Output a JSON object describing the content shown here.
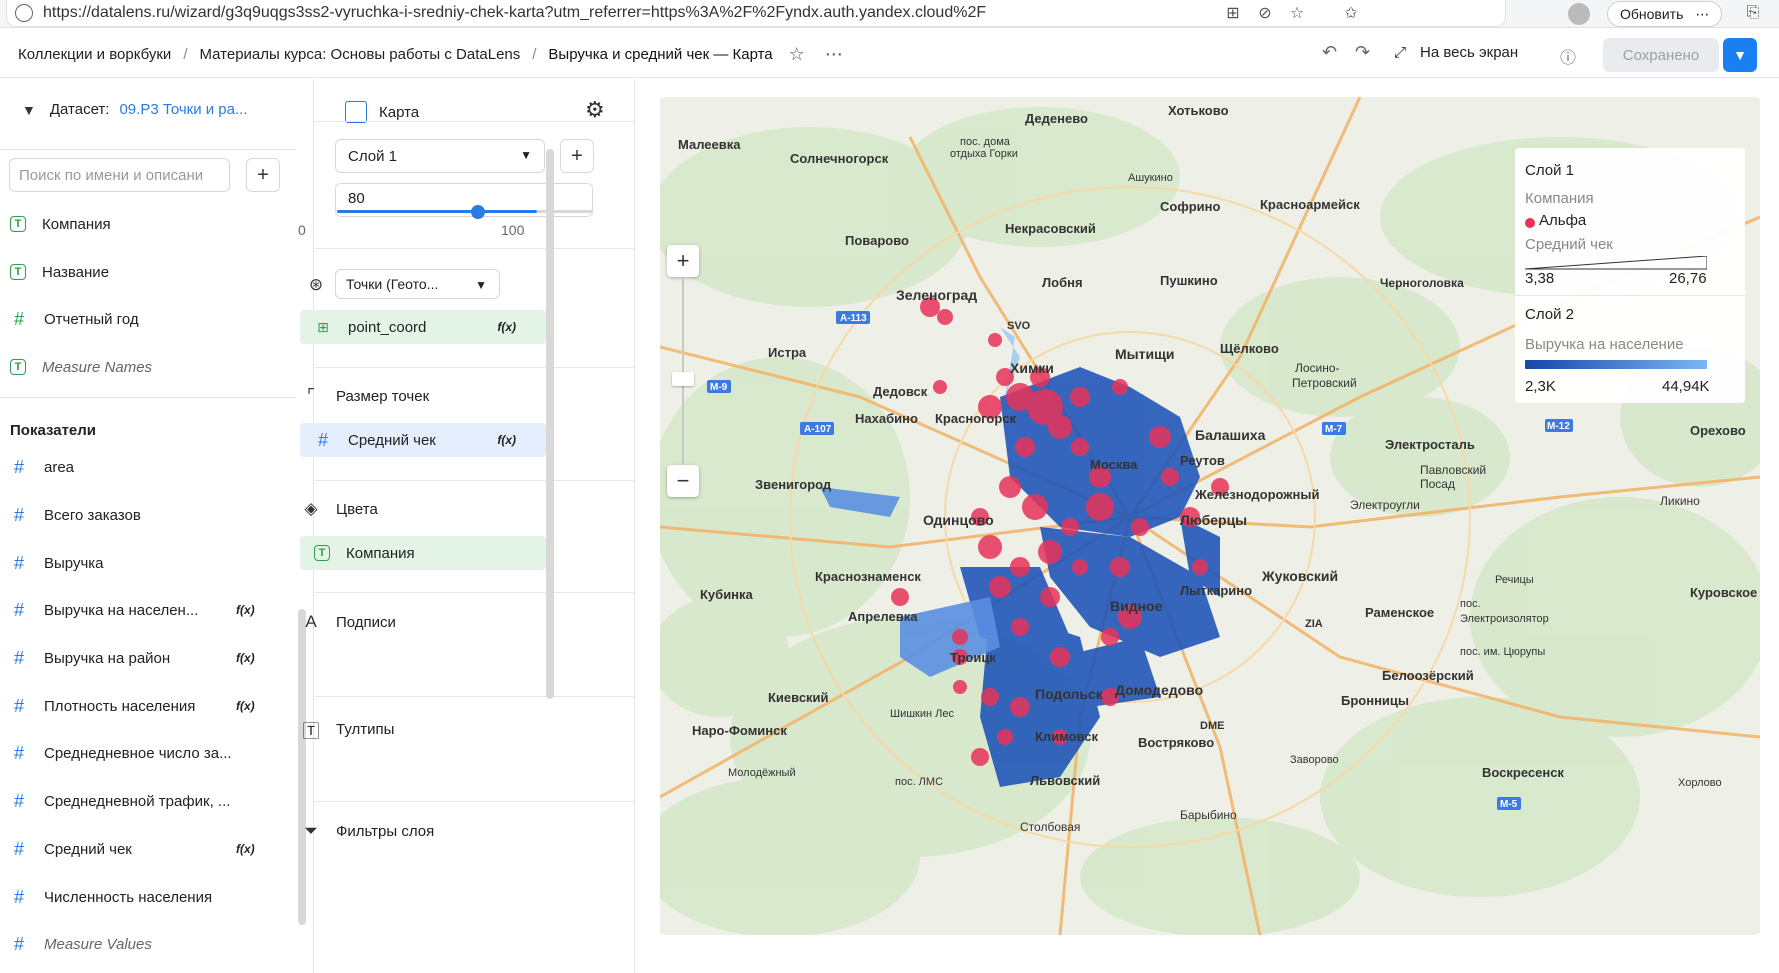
{
  "browser": {
    "url": "https://datalens.ru/wizard/g3q9uqgs3ss2-vyruchka-i-sredniy-chek-karta?utm_referrer=https%3A%2F%2Fyndx.auth.yandex.cloud%2F",
    "update_label": "Обновить"
  },
  "header": {
    "crumbs": [
      "Коллекции и воркбуки",
      "Материалы курса: Основы работы с DataLens"
    ],
    "current": "Выручка и средний чек — Карта",
    "fullscreen_label": "На весь экран",
    "saved_label": "Сохранено"
  },
  "left": {
    "dataset_label": "Датасет:",
    "dataset_name": "09.Р3 Точки и ра...",
    "search_placeholder": "Поиск по имени и описани",
    "dimensions": [
      {
        "label": "Компания",
        "type": "T"
      },
      {
        "label": "Название",
        "type": "T"
      },
      {
        "label": "Отчетный год",
        "type": "#g"
      },
      {
        "label": "Measure Names",
        "type": "T"
      }
    ],
    "measures_title": "Показатели",
    "measures": [
      {
        "label": "area",
        "fx": ""
      },
      {
        "label": "Всего заказов",
        "fx": ""
      },
      {
        "label": "Выручка",
        "fx": ""
      },
      {
        "label": "Выручка на населен...",
        "fx": "f(x)"
      },
      {
        "label": "Выручка на район",
        "fx": "f(x)"
      },
      {
        "label": "Плотность населения",
        "fx": "f(x)"
      },
      {
        "label": "Среднедневное число за...",
        "fx": ""
      },
      {
        "label": "Среднедневной трафик, ...",
        "fx": ""
      },
      {
        "label": "Средний чек",
        "fx": "f(x)"
      },
      {
        "label": "Численность населения",
        "fx": ""
      },
      {
        "label": "Measure Values",
        "fx": ""
      }
    ]
  },
  "mid": {
    "viz_label": "Карта",
    "layer_label": "Слой 1",
    "opacity_value": "80",
    "opacity_min": "0",
    "opacity_max": "100",
    "geo_type": "Точки (Геото...",
    "geo_field": "point_coord",
    "size_label": "Размер точек",
    "size_field": "Средний чек",
    "colors_label": "Цвета",
    "colors_field": "Компания",
    "labels_label": "Подписи",
    "tooltips_label": "Тултипы",
    "filters_label": "Фильтры слоя",
    "fx": "f(x)"
  },
  "legend": {
    "layer1": "Слой 1",
    "company_title": "Компания",
    "company_value": "Альфа",
    "company_color": "#e8335a",
    "check_title": "Средний чек",
    "check_min": "3,38",
    "check_max": "26,76",
    "layer2": "Слой 2",
    "rev_title": "Выручка на население",
    "rev_min": "2,3K",
    "rev_max": "44,94K"
  },
  "map": {
    "cities": [
      {
        "name": "Хотьково"
      },
      {
        "name": "Деденево"
      },
      {
        "name": "Малеевка"
      },
      {
        "name": "пос. дома отдыха Горки"
      },
      {
        "name": "Солнечногорск"
      },
      {
        "name": "Ашукино"
      },
      {
        "name": "Софрино"
      },
      {
        "name": "Красноармейск"
      },
      {
        "name": "Некрасовский"
      },
      {
        "name": "Поварово"
      },
      {
        "name": "Лобня"
      },
      {
        "name": "Пушкино"
      },
      {
        "name": "Зеленоград"
      },
      {
        "name": "SVO"
      },
      {
        "name": "Черноголовка"
      },
      {
        "name": "Истра"
      },
      {
        "name": "Мытищи"
      },
      {
        "name": "Щёлково"
      },
      {
        "name": "Химки"
      },
      {
        "name": "Лосино-Петровский"
      },
      {
        "name": "Дедовск"
      },
      {
        "name": "Нахабино"
      },
      {
        "name": "Красногорск"
      },
      {
        "name": "Балашиха"
      },
      {
        "name": "Электросталь"
      },
      {
        "name": "Звенигород"
      },
      {
        "name": "Москва"
      },
      {
        "name": "Реутов"
      },
      {
        "name": "Железнодорожный"
      },
      {
        "name": "Павловский Посад"
      },
      {
        "name": "Одинцово"
      },
      {
        "name": "Люберцы"
      },
      {
        "name": "Электроугли"
      },
      {
        "name": "Ликино"
      },
      {
        "name": "Краснознаменск"
      },
      {
        "name": "Жуковский"
      },
      {
        "name": "Кубинка"
      },
      {
        "name": "Апрелевка"
      },
      {
        "name": "Видное"
      },
      {
        "name": "Лыткарино"
      },
      {
        "name": "Речицы"
      },
      {
        "name": "ZIA"
      },
      {
        "name": "Раменское"
      },
      {
        "name": "пос. Электроизолятор"
      },
      {
        "name": "Троицк"
      },
      {
        "name": "пос. им. Цюрупы"
      },
      {
        "name": "Киевский"
      },
      {
        "name": "Подольск"
      },
      {
        "name": "Домодедово"
      },
      {
        "name": "Белоозёрский"
      },
      {
        "name": "Шишкин Лес"
      },
      {
        "name": "Бронницы"
      },
      {
        "name": "Наро-Фоминск"
      },
      {
        "name": "DME"
      },
      {
        "name": "Климовск"
      },
      {
        "name": "Востряково"
      },
      {
        "name": "Заворово"
      },
      {
        "name": "Молодёжный"
      },
      {
        "name": "пос. ЛМС"
      },
      {
        "name": "Львовский"
      },
      {
        "name": "Воскресенск"
      },
      {
        "name": "Хорлово"
      },
      {
        "name": "Столбовая"
      },
      {
        "name": "Барыбино"
      },
      {
        "name": "Орехово"
      },
      {
        "name": "Куровское"
      }
    ],
    "roads": [
      "А-113",
      "М-9",
      "А-107",
      "М-7",
      "М-12",
      "М-5"
    ]
  }
}
